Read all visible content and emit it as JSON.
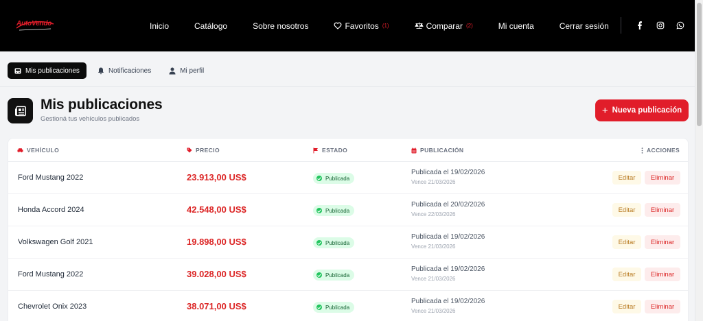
{
  "brand": {
    "name": "AutoVendo",
    "accent": "#e11d2a"
  },
  "nav": {
    "items": [
      {
        "label": "Inicio"
      },
      {
        "label": "Catálogo"
      },
      {
        "label": "Sobre nosotros"
      },
      {
        "label": "Favoritos",
        "count": "(1)"
      },
      {
        "label": "Comparar",
        "count": "(2)"
      },
      {
        "label": "Mi cuenta"
      },
      {
        "label": "Cerrar sesión"
      }
    ],
    "social": [
      "facebook-icon",
      "instagram-icon",
      "whatsapp-icon"
    ]
  },
  "tabs": [
    {
      "label": "Mis publicaciones",
      "active": true
    },
    {
      "label": "Notificaciones",
      "active": false
    },
    {
      "label": "Mi perfil",
      "active": false
    }
  ],
  "header": {
    "title": "Mis publicaciones",
    "subtitle": "Gestioná tus vehículos publicados",
    "new_button": "Nueva publicación"
  },
  "table": {
    "columns": [
      "VEHÍCULO",
      "PRECIO",
      "ESTADO",
      "PUBLICACIÓN",
      "ACCIONES"
    ],
    "edit_label": "Editar",
    "delete_label": "Eliminar",
    "rows": [
      {
        "vehicle": "Ford Mustang 2022",
        "price": "23.913,00 US$",
        "status": "Publicada",
        "published": "Publicada el 19/02/2026",
        "expires": "Vence 21/03/2026"
      },
      {
        "vehicle": "Honda Accord 2024",
        "price": "42.548,00 US$",
        "status": "Publicada",
        "published": "Publicada el 20/02/2026",
        "expires": "Vence 22/03/2026"
      },
      {
        "vehicle": "Volkswagen Golf 2021",
        "price": "19.898,00 US$",
        "status": "Publicada",
        "published": "Publicada el 19/02/2026",
        "expires": "Vence 21/03/2026"
      },
      {
        "vehicle": "Ford Mustang 2022",
        "price": "39.028,00 US$",
        "status": "Publicada",
        "published": "Publicada el 19/02/2026",
        "expires": "Vence 21/03/2026"
      },
      {
        "vehicle": "Chevrolet Onix 2023",
        "price": "38.071,00 US$",
        "status": "Publicada",
        "published": "Publicada el 19/02/2026",
        "expires": "Vence 21/03/2026"
      }
    ]
  }
}
